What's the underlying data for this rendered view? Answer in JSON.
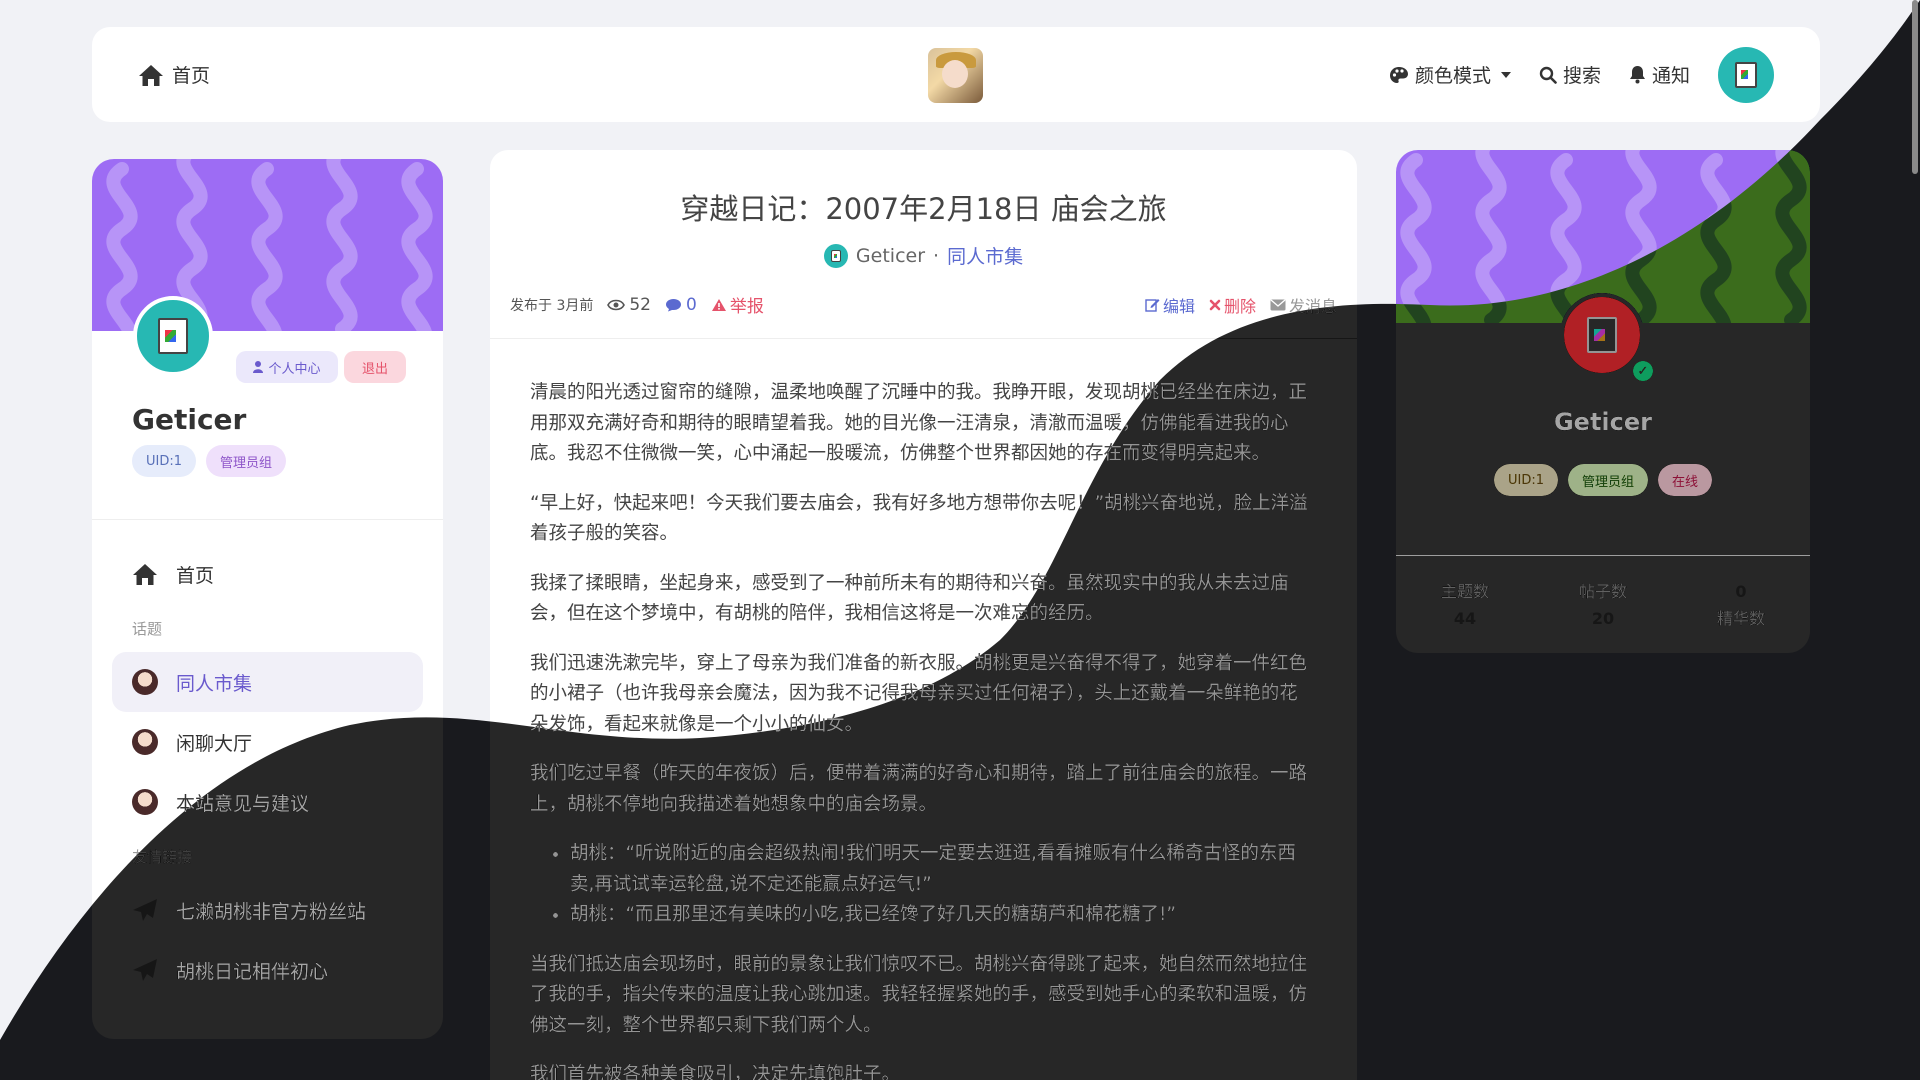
{
  "nav": {
    "home": "首页",
    "color_mode": "颜色模式",
    "search": "搜索",
    "notify": "通知"
  },
  "sidebar": {
    "user_center": "个人中心",
    "logout": "退出",
    "username": "Geticer",
    "uid": "UID:1",
    "group": "管理员组",
    "home": "首页",
    "topics_label": "话题",
    "topics": [
      {
        "label": "同人市集"
      },
      {
        "label": "闲聊大厅"
      },
      {
        "label": "本站意见与建议"
      }
    ],
    "links_label": "友情链接",
    "links": [
      {
        "label": "七濑胡桃非官方粉丝站"
      },
      {
        "label": "胡桃日记相伴初心"
      }
    ]
  },
  "article": {
    "title": "穿越日记：2007年2月18日 庙会之旅",
    "author": "Geticer",
    "separator": "·",
    "category": "同人市集",
    "published": "发布于 3月前",
    "views": "52",
    "comments": "0",
    "report": "举报",
    "edit": "编辑",
    "delete": "删除",
    "message": "发消息",
    "paragraphs": [
      "清晨的阳光透过窗帘的缝隙，温柔地唤醒了沉睡中的我。我睁开眼，发现胡桃已经坐在床边，正用那双充满好奇和期待的眼睛望着我。她的目光像一汪清泉，清澈而温暖，仿佛能看进我的心底。我忍不住微微一笑，心中涌起一股暖流，仿佛整个世界都因她的存在而变得明亮起来。",
      "“早上好，快起来吧！今天我们要去庙会，我有好多地方想带你去呢！”胡桃兴奋地说，脸上洋溢着孩子般的笑容。",
      "我揉了揉眼睛，坐起身来，感受到了一种前所未有的期待和兴奋。虽然现实中的我从未去过庙会，但在这个梦境中，有胡桃的陪伴，我相信这将是一次难忘的经历。",
      "我们迅速洗漱完毕，穿上了母亲为我们准备的新衣服。胡桃更是兴奋得不得了，她穿着一件红色的小裙子（也许我母亲会魔法，因为我不记得我母亲买过任何裙子），头上还戴着一朵鲜艳的花朵发饰，看起来就像是一个小小的仙女。",
      "我们吃过早餐（昨天的年夜饭）后，便带着满满的好奇心和期待，踏上了前往庙会的旅程。一路上，胡桃不停地向我描述着她想象中的庙会场景。"
    ],
    "bullets": [
      "胡桃：“听说附近的庙会超级热闹!我们明天一定要去逛逛,看看摊贩有什么稀奇古怪的东西卖,再试试幸运轮盘,说不定还能赢点好运气!”",
      "胡桃：“而且那里还有美味的小吃,我已经馋了好几天的糖葫芦和棉花糖了!”"
    ],
    "paragraphs_after": [
      "当我们抵达庙会现场时，眼前的景象让我们惊叹不已。胡桃兴奋得跳了起来，她自然而然地拉住了我的手，指尖传来的温度让我心跳加速。我轻轻握紧她的手，感受到她手心的柔软和温暖，仿佛这一刻，整个世界都只剩下我们两个人。",
      "我们首先被各种美食吸引，决定先填饱肚子。"
    ]
  },
  "profile": {
    "username": "Geticer",
    "uid": "UID:1",
    "group": "管理员组",
    "status": "在线",
    "stats": [
      {
        "label": "主题数",
        "value": "44"
      },
      {
        "label": "帖子数",
        "value": "20"
      },
      {
        "label": "精华数",
        "value": "0"
      }
    ]
  },
  "colors": {
    "accent": "#6a5acd",
    "banner": "#9d6cf4",
    "avatar_bg": "#27b8b3",
    "dark": "#2a2a2a",
    "danger": "#e5536b"
  }
}
